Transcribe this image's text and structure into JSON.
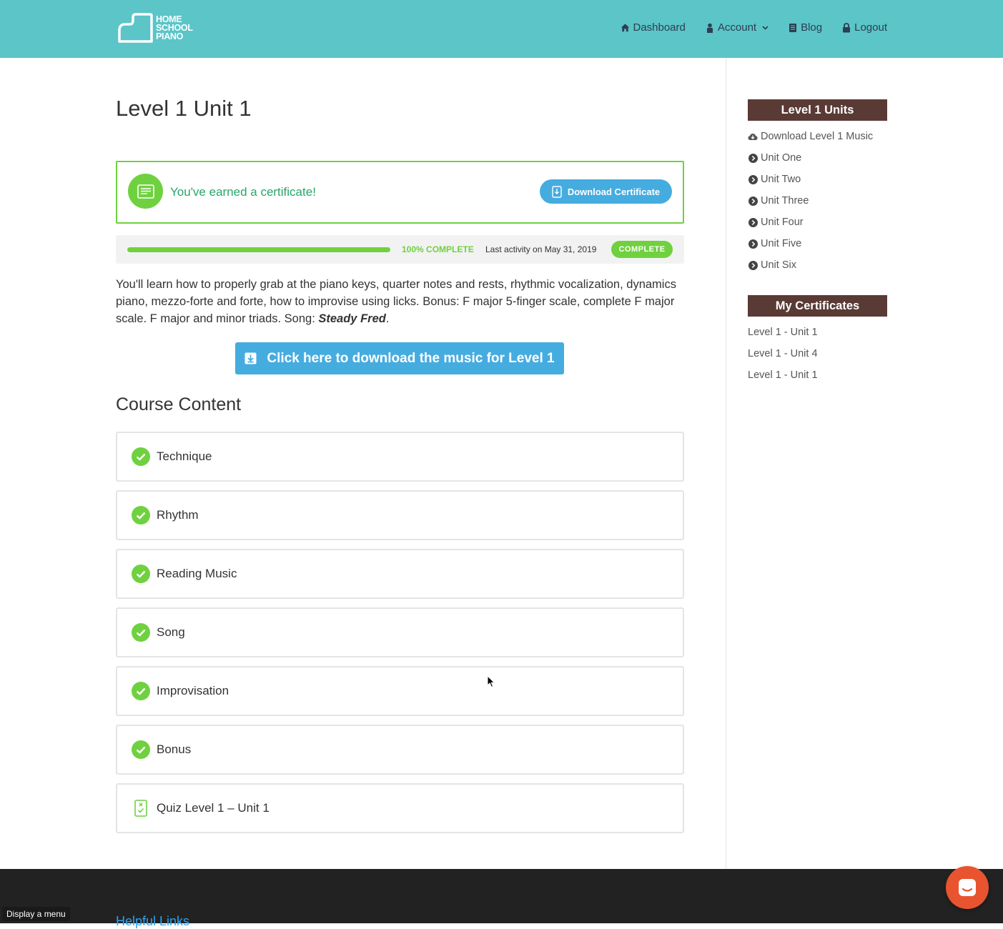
{
  "header": {
    "logo": {
      "line1": "HOME",
      "line2": "SCHOOL",
      "line3": "PIANO"
    },
    "nav": [
      {
        "label": "Dashboard",
        "icon": "home-icon"
      },
      {
        "label": "Account",
        "icon": "user-icon"
      },
      {
        "label": "Blog",
        "icon": "book-icon"
      },
      {
        "label": "Logout",
        "icon": "lock-icon"
      }
    ]
  },
  "main": {
    "title": "Level 1 Unit 1",
    "certificate": {
      "message": "You've earned a certificate!",
      "button_label": "Download Certificate"
    },
    "progress": {
      "percent": 100,
      "percent_label": "100% COMPLETE",
      "last_activity": "Last activity on May 31, 2019",
      "status_badge": "COMPLETE"
    },
    "description": {
      "text": "You'll learn how to properly grab at the piano keys, quarter notes and rests, rhythmic vocalization, dynamics piano, mezzo-forte and forte, how to improvise using licks. Bonus: F major 5-finger scale, complete F major scale. F major and minor triads. Song: ",
      "song": "Steady Fred",
      "end": "."
    },
    "download_music_label": "Click here to download the music for Level 1",
    "course_content_title": "Course Content",
    "lessons": [
      {
        "label": "Technique",
        "status": "complete"
      },
      {
        "label": "Rhythm",
        "status": "complete"
      },
      {
        "label": "Reading Music",
        "status": "complete"
      },
      {
        "label": "Song",
        "status": "complete"
      },
      {
        "label": "Improvisation",
        "status": "complete"
      },
      {
        "label": "Bonus",
        "status": "complete"
      },
      {
        "label": "Quiz Level 1 – Unit 1",
        "status": "quiz"
      }
    ]
  },
  "sidebar": {
    "units_title": "Level 1 Units",
    "units": [
      {
        "label": "Download Level 1 Music",
        "icon": "cloud-download-icon"
      },
      {
        "label": "Unit One",
        "icon": "chevron-circle-icon"
      },
      {
        "label": "Unit Two",
        "icon": "chevron-circle-icon"
      },
      {
        "label": "Unit Three",
        "icon": "chevron-circle-icon"
      },
      {
        "label": "Unit Four",
        "icon": "chevron-circle-icon"
      },
      {
        "label": "Unit Five",
        "icon": "chevron-circle-icon"
      },
      {
        "label": "Unit Six",
        "icon": "chevron-circle-icon"
      }
    ],
    "certificates_title": "My Certificates",
    "certificates": [
      {
        "label": "Level 1 - Unit 1"
      },
      {
        "label": "Level 1 - Unit 4"
      },
      {
        "label": "Level 1 - Unit 1"
      }
    ]
  },
  "footer": {
    "helpful_links": "Helpful Links",
    "display_menu": "Display a menu"
  },
  "colors": {
    "header_bg": "#5bc5c8",
    "accent_green": "#6fd13f",
    "accent_blue": "#45ace0",
    "sidebar_head": "#5a3a35",
    "chat_orange": "#e8542f"
  }
}
